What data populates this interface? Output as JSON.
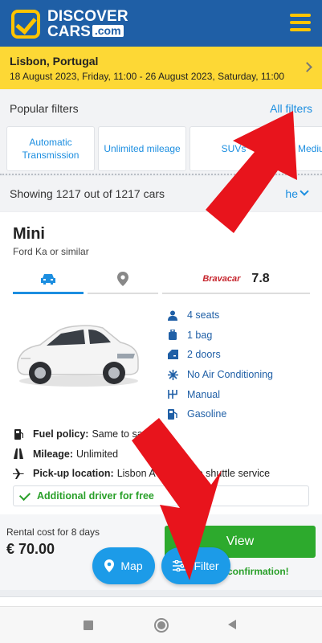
{
  "header": {
    "logo_line1": "DISCOVER",
    "logo_line2": "CARS",
    "logo_domain": ".com",
    "menu_icon": "hamburger-icon",
    "brand_color": "#1f5fa6",
    "accent_color": "#ffc400"
  },
  "search": {
    "location": "Lisbon, Portugal",
    "dates": "18 August 2023, Friday, 11:00 - 26 August 2023, Saturday, 11:00"
  },
  "popular_filters": {
    "title": "Popular filters",
    "all_filters": "All filters",
    "chips": [
      {
        "line1": "Automatic",
        "line2": "Transmission"
      },
      {
        "label": "Unlimited mileage"
      },
      {
        "label": "SUVs"
      },
      {
        "label": "Mediu"
      }
    ]
  },
  "results": {
    "showing": "Showing 1217 out of 1217 cars",
    "sort_label": "he"
  },
  "car": {
    "class": "Mini",
    "model": "Ford Ka or similar",
    "supplier": "Bravacar",
    "rating": "7.8",
    "specs": [
      {
        "icon": "person-icon",
        "label": "4 seats"
      },
      {
        "icon": "luggage-icon",
        "label": "1 bag"
      },
      {
        "icon": "car-door-icon",
        "label": "2 doors"
      },
      {
        "icon": "snowflake-icon",
        "label": "No Air Conditioning"
      },
      {
        "icon": "gearbox-icon",
        "label": "Manual"
      },
      {
        "icon": "fuel-icon",
        "label": "Gasoline"
      }
    ],
    "info": [
      {
        "icon": "fuel-policy-icon",
        "label": "Fuel policy:",
        "value": "Same to sa"
      },
      {
        "icon": "road-icon",
        "label": "Mileage:",
        "value": "Unlimited"
      },
      {
        "icon": "plane-icon",
        "label": "Pick-up location:",
        "value": "Lisbon A      (LIS) Free shuttle service"
      }
    ],
    "additional": "Additional driver for free",
    "rental_label": "Rental cost for 8 days",
    "price": "€ 70.00",
    "view_label": "View",
    "confirmation": "confirmation!"
  },
  "fabs": {
    "map": "Map",
    "filter": "Filter"
  },
  "colors": {
    "link": "#1c8ee0",
    "green": "#2daa2d",
    "arrow": "#e8141c"
  }
}
